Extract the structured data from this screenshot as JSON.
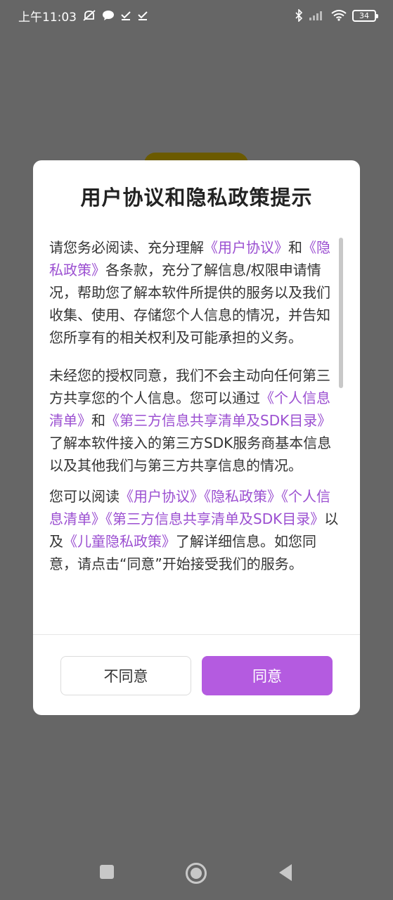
{
  "status_bar": {
    "time": "上午11:03",
    "battery": "34",
    "icons": [
      "mute-icon",
      "chat-icon",
      "check-icon",
      "check-icon",
      "bluetooth-icon",
      "signal-icon",
      "wifi-icon",
      "battery-icon"
    ]
  },
  "dialog": {
    "title": "用户协议和隐私政策提示",
    "paragraph1": {
      "t1": "请您务必阅读、充分理解",
      "l1": "《用户协议》",
      "t2": "和",
      "l2": "《隐私政策》",
      "t3": "各条款，充分了解信息/权限申请情况，帮助您了解本软件所提供的服务以及我们收集、使用、存储您个人信息的情况，并告知您所享有的相关权利及可能承担的义务。"
    },
    "paragraph2": {
      "t1": "未经您的授权同意，我们不会主动向任何第三方共享您的个人信息。您可以通过",
      "l1": "《个人信息清单》",
      "t2": "和",
      "l2": "《第三方信息共享清单及SDK目录》",
      "t3": "了解本软件接入的第三方SDK服务商基本信息以及其他我们与第三方共享信息的情况。"
    },
    "paragraph3": {
      "t1": "您可以阅读",
      "l1": "《用户协议》",
      "l2": "《隐私政策》",
      "l3": "《个人信息清单》",
      "l4": "《第三方信息共享清单及SDK目录》",
      "t2": "以及",
      "l5": "《儿童隐私政策》",
      "t3": "了解详细信息。如您同意，请点击“同意”开始接受我们的服务。"
    },
    "disagree_label": "不同意",
    "agree_label": "同意"
  },
  "colors": {
    "link": "#9b4fd1",
    "agree_button": "#b45be0",
    "overlay": "#666666"
  }
}
